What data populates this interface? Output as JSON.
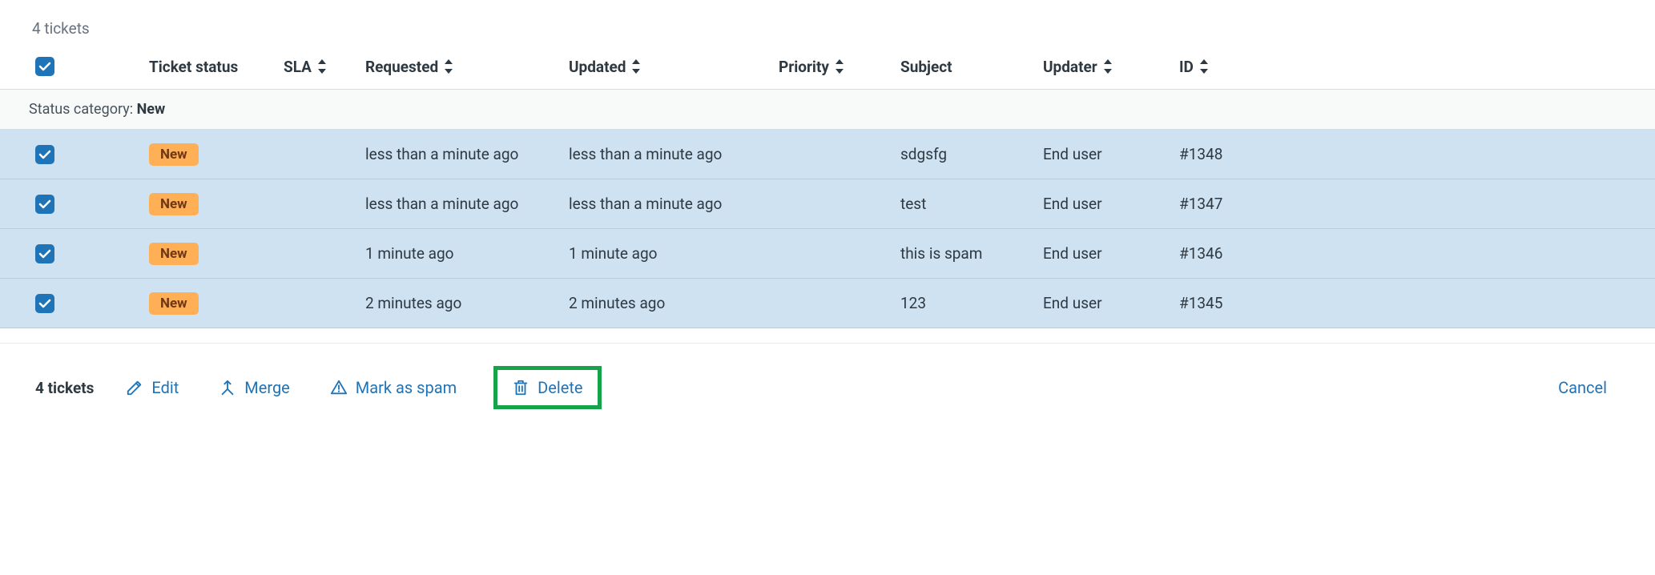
{
  "top_count": "4 tickets",
  "columns": {
    "status": "Ticket status",
    "sla": "SLA",
    "requested": "Requested",
    "updated": "Updated",
    "priority": "Priority",
    "subject": "Subject",
    "updater": "Updater",
    "id": "ID"
  },
  "group": {
    "label": "Status category: ",
    "value": "New"
  },
  "badge_new": "New",
  "rows": [
    {
      "requested": "less than a minute ago",
      "updated": "less than a minute ago",
      "subject": "sdgsfg",
      "updater": "End user",
      "id": "#1348"
    },
    {
      "requested": "less than a minute ago",
      "updated": "less than a minute ago",
      "subject": "test",
      "updater": "End user",
      "id": "#1347"
    },
    {
      "requested": "1 minute ago",
      "updated": "1 minute ago",
      "subject": "this is spam",
      "updater": "End user",
      "id": "#1346"
    },
    {
      "requested": "2 minutes ago",
      "updated": "2 minutes ago",
      "subject": "123",
      "updater": "End user",
      "id": "#1345"
    }
  ],
  "actions": {
    "selected": "4 tickets",
    "edit": "Edit",
    "merge": "Merge",
    "spam": "Mark as spam",
    "delete": "Delete",
    "cancel": "Cancel"
  }
}
